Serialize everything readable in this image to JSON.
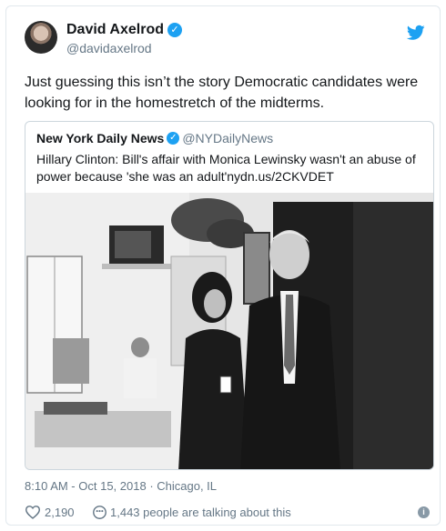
{
  "tweet": {
    "author_name": "David Axelrod",
    "author_handle": "@davidaxelrod",
    "text": "Just guessing this isn’t the story Democratic candidates were looking for in the homestretch of the midterms.",
    "timestamp": "8:10 AM - Oct 15, 2018",
    "location": " · Chicago, IL",
    "likes": "2,190",
    "talking": "1,443 people are talking about this"
  },
  "quoted": {
    "name": "New York Daily News",
    "handle": "@NYDailyNews",
    "text": "Hillary Clinton: Bill's affair with Monica Lewinsky wasn't an abuse of power because 'she was an adult'nydn.us/2CKVDET"
  },
  "colors": {
    "twitter_blue": "#1da1f2",
    "secondary_text": "#657786",
    "border": "#e1e8ed"
  },
  "icons": [
    "twitter-bird-icon",
    "verified-badge-icon",
    "heart-icon",
    "talking-icon",
    "info-icon"
  ]
}
